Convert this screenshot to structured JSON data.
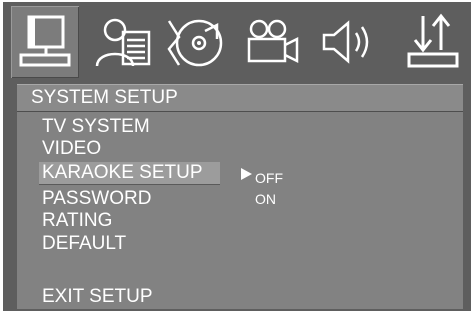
{
  "tabs": [
    {
      "icon": "system-setup-icon",
      "selected": true
    },
    {
      "icon": "language-setup-icon",
      "selected": false
    },
    {
      "icon": "audio-disc-icon",
      "selected": false
    },
    {
      "icon": "video-camera-icon",
      "selected": false
    },
    {
      "icon": "speaker-icon",
      "selected": false
    },
    {
      "icon": "sort-arrows-icon",
      "selected": false
    }
  ],
  "section": {
    "title": "SYSTEM SETUP"
  },
  "menu": {
    "items": [
      {
        "label": "TV SYSTEM"
      },
      {
        "label": "VIDEO"
      },
      {
        "label": "KARAOKE SETUP",
        "highlighted": true
      },
      {
        "label": "PASSWORD"
      },
      {
        "label": "RATING"
      },
      {
        "label": "DEFAULT"
      },
      {
        "label": "EXIT SETUP"
      }
    ]
  },
  "submenu": {
    "options": [
      "OFF",
      "ON"
    ]
  },
  "colors": {
    "background": "#5e5e5e",
    "panel": "#828282",
    "title_bar": "#8a8a8a",
    "highlight": "#9c9c9c",
    "text": "#ffffff"
  }
}
